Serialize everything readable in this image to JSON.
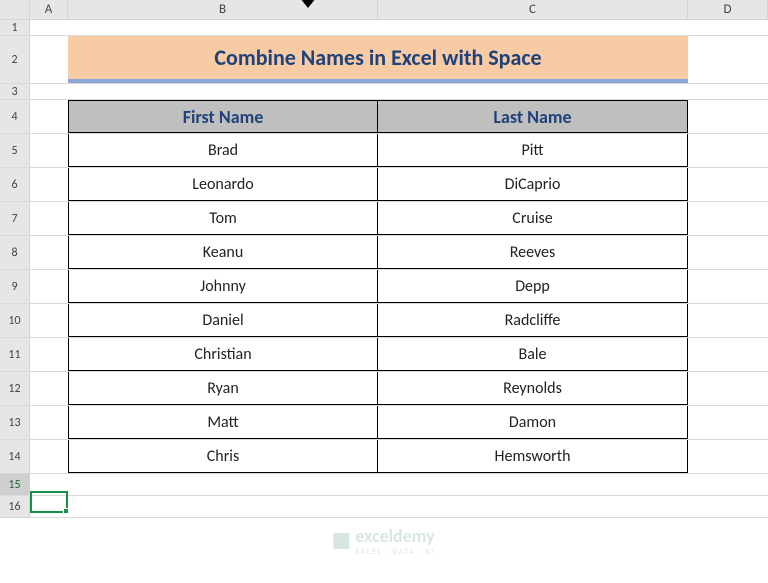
{
  "columns": {
    "rowcol": "",
    "A": "A",
    "B": "B",
    "C": "C",
    "D": "D"
  },
  "rows": [
    "1",
    "2",
    "3",
    "4",
    "5",
    "6",
    "7",
    "8",
    "9",
    "10",
    "11",
    "12",
    "13",
    "14",
    "15",
    "16"
  ],
  "title": "Combine Names in Excel with Space",
  "headers": {
    "first": "First Name",
    "last": "Last Name"
  },
  "data": [
    {
      "first": "Brad",
      "last": "Pitt"
    },
    {
      "first": "Leonardo",
      "last": "DiCaprio"
    },
    {
      "first": "Tom",
      "last": "Cruise"
    },
    {
      "first": "Keanu",
      "last": "Reeves"
    },
    {
      "first": "Johnny",
      "last": "Depp"
    },
    {
      "first": "Daniel",
      "last": "Radcliffe"
    },
    {
      "first": "Christian",
      "last": "Bale"
    },
    {
      "first": "Ryan",
      "last": "Reynolds"
    },
    {
      "first": "Matt",
      "last": "Damon"
    },
    {
      "first": "Chris",
      "last": "Hemsworth"
    }
  ],
  "watermark": {
    "brand": "exceldemy",
    "tagline": "EXCEL · DATA · BI"
  },
  "chart_data": {
    "type": "table",
    "title": "Combine Names in Excel with Space",
    "columns": [
      "First Name",
      "Last Name"
    ],
    "rows": [
      [
        "Brad",
        "Pitt"
      ],
      [
        "Leonardo",
        "DiCaprio"
      ],
      [
        "Tom",
        "Cruise"
      ],
      [
        "Keanu",
        "Reeves"
      ],
      [
        "Johnny",
        "Depp"
      ],
      [
        "Daniel",
        "Radcliffe"
      ],
      [
        "Christian",
        "Bale"
      ],
      [
        "Ryan",
        "Reynolds"
      ],
      [
        "Matt",
        "Damon"
      ],
      [
        "Chris",
        "Hemsworth"
      ]
    ]
  }
}
